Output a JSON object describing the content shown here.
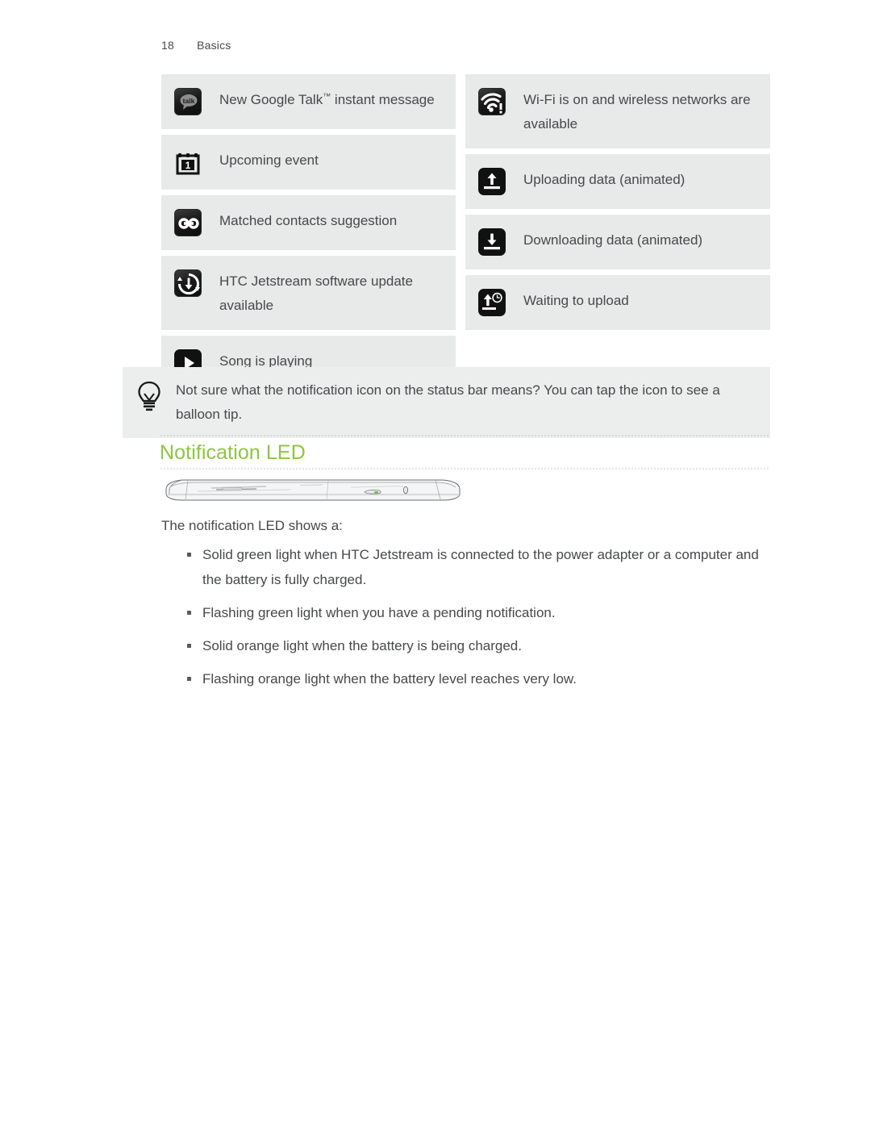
{
  "header": {
    "page_number": "18",
    "section": "Basics"
  },
  "icon_table": {
    "left_column": [
      {
        "icon": "google-talk-icon",
        "label_pre": "New Google Talk",
        "label_tm": "™",
        "label_post": " instant message",
        "label": "New Google Talk™ instant message"
      },
      {
        "icon": "calendar-event-icon",
        "label": "Upcoming event"
      },
      {
        "icon": "matched-contacts-icon",
        "label": "Matched contacts suggestion"
      },
      {
        "icon": "software-update-icon",
        "label": "HTC Jetstream software update available"
      },
      {
        "icon": "music-play-icon",
        "label": "Song is playing"
      }
    ],
    "right_column": [
      {
        "icon": "wifi-available-icon",
        "label": "Wi-Fi is on and wireless networks are available"
      },
      {
        "icon": "upload-icon",
        "label": "Uploading data (animated)"
      },
      {
        "icon": "download-icon",
        "label": "Downloading data (animated)"
      },
      {
        "icon": "waiting-upload-icon",
        "label": "Waiting to upload"
      }
    ]
  },
  "tip": {
    "icon": "lightbulb-icon",
    "text": "Not sure what the notification icon on the status bar means? You can tap the icon to see a balloon tip."
  },
  "section": {
    "heading": "Notification LED",
    "heading_color": "#8cc63f"
  },
  "device_image": {
    "alt": "HTC Jetstream tablet edge view showing notification LED",
    "led_color": "#5ec832"
  },
  "body": {
    "intro": "The notification LED shows a:",
    "bullets": [
      "Solid green light when HTC Jetstream is connected to the power adapter or a computer and the battery is fully charged.",
      "Flashing green light when you have a pending notification.",
      "Solid orange light when the battery is being charged.",
      "Flashing orange light when the battery level reaches very low."
    ]
  }
}
